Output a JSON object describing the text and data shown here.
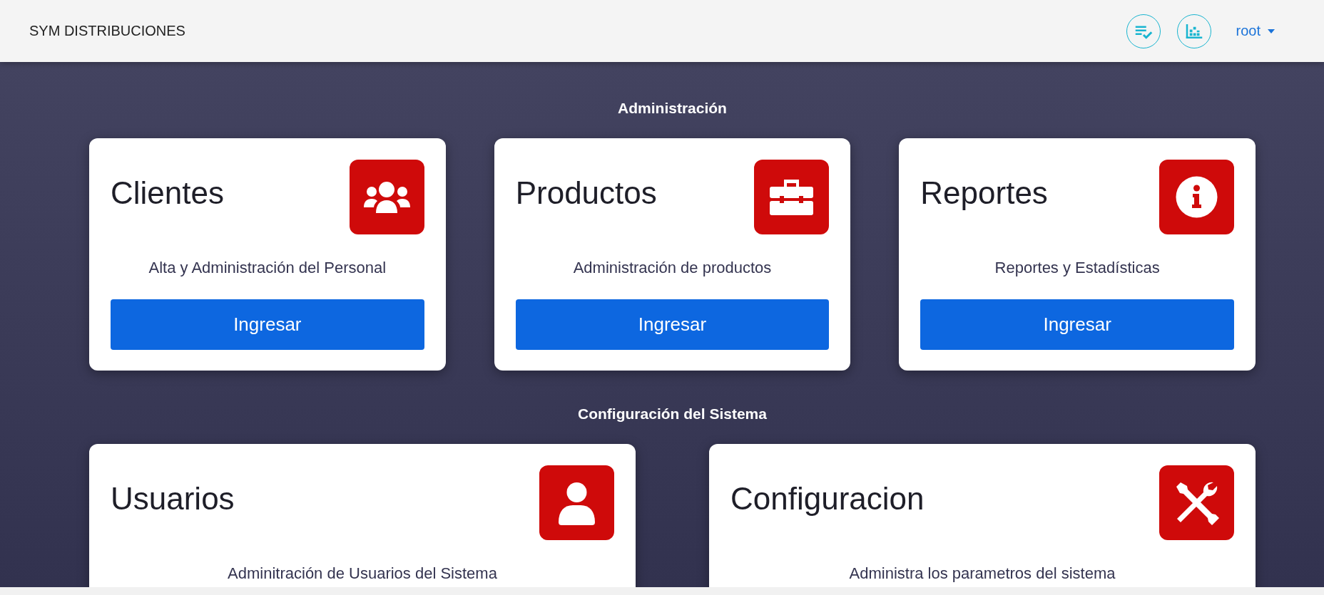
{
  "header": {
    "brand": "SYM DISTRIBUCIONES",
    "user_menu": {
      "label": "root"
    }
  },
  "sections": [
    {
      "title": "Administración",
      "cards": [
        {
          "title": "Clientes",
          "description": "Alta y Administración del Personal",
          "button": "Ingresar"
        },
        {
          "title": "Productos",
          "description": "Administración de productos",
          "button": "Ingresar"
        },
        {
          "title": "Reportes",
          "description": "Reportes y Estadísticas",
          "button": "Ingresar"
        }
      ]
    },
    {
      "title": "Configuración del Sistema",
      "cards": [
        {
          "title": "Usuarios",
          "description": "Adminitración de Usuarios del Sistema"
        },
        {
          "title": "Configuracion",
          "description": "Administra los parametros del sistema"
        }
      ]
    }
  ]
}
